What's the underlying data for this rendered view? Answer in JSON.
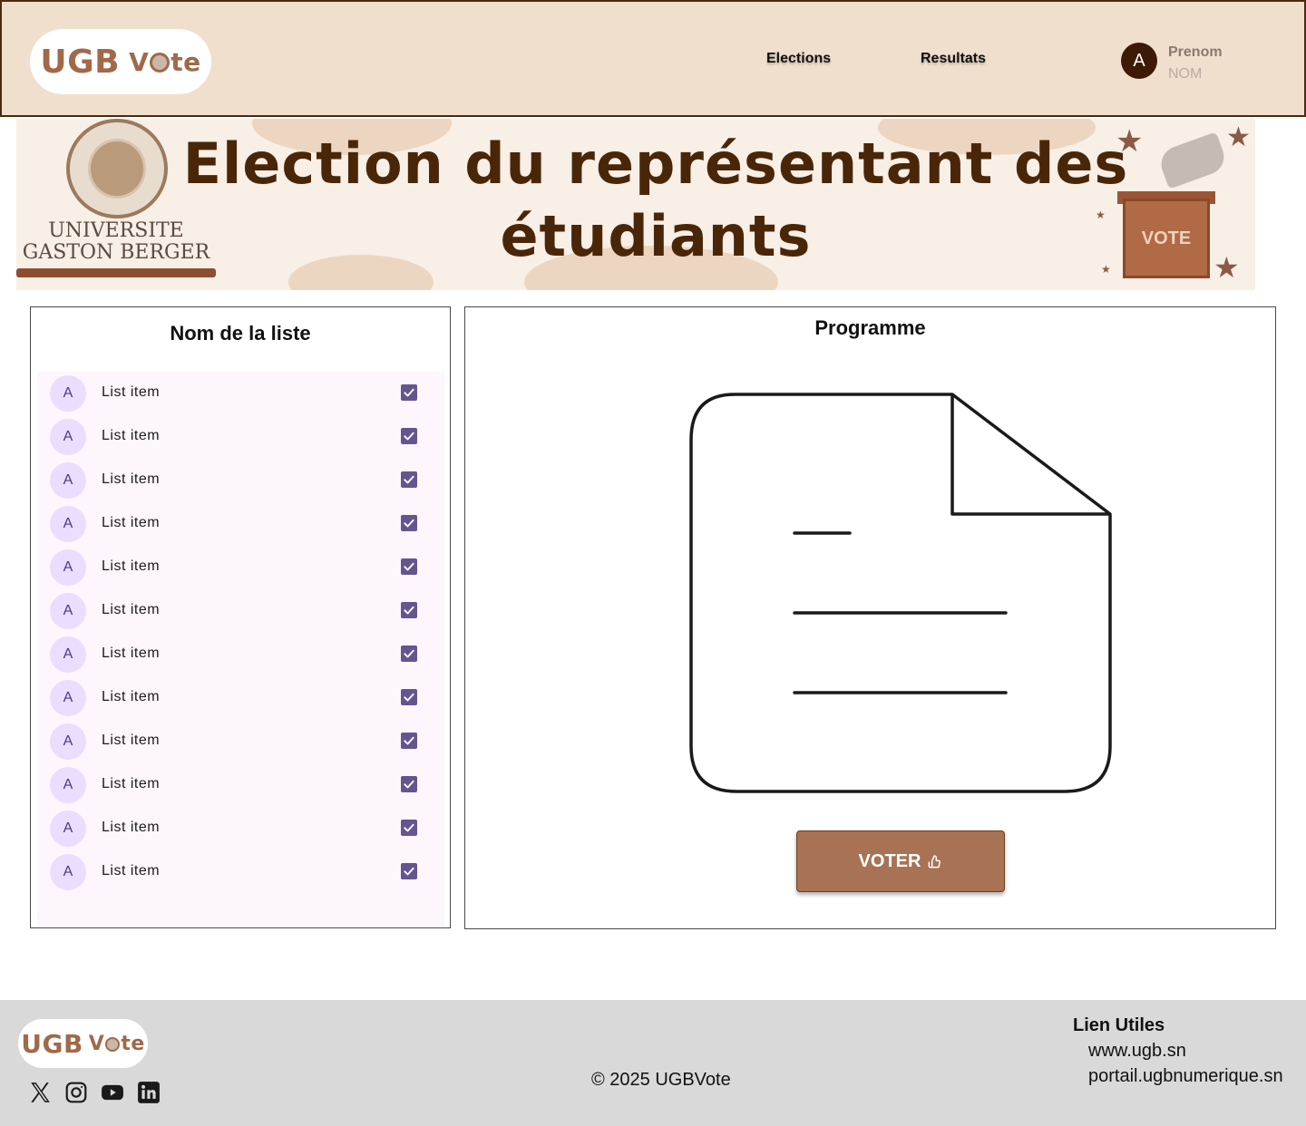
{
  "header": {
    "logo": "UGB Vote",
    "nav": [
      {
        "label": "Elections"
      },
      {
        "label": "Resultats"
      }
    ],
    "user": {
      "avatar_initial": "A",
      "first_name": "Prenom",
      "last_name": "NOM"
    }
  },
  "banner": {
    "title": "Election du représentant des étudiants",
    "university": "UNIVERSITE GASTON BERGER",
    "ballot_label": "VOTE"
  },
  "list_panel": {
    "title": "Nom de la liste",
    "items": [
      {
        "avatar": "A",
        "label": "List item",
        "checked": true
      },
      {
        "avatar": "A",
        "label": "List item",
        "checked": true
      },
      {
        "avatar": "A",
        "label": "List item",
        "checked": true
      },
      {
        "avatar": "A",
        "label": "List item",
        "checked": true
      },
      {
        "avatar": "A",
        "label": "List item",
        "checked": true
      },
      {
        "avatar": "A",
        "label": "List item",
        "checked": true
      },
      {
        "avatar": "A",
        "label": "List item",
        "checked": true
      },
      {
        "avatar": "A",
        "label": "List item",
        "checked": true
      },
      {
        "avatar": "A",
        "label": "List item",
        "checked": true
      },
      {
        "avatar": "A",
        "label": "List item",
        "checked": true
      },
      {
        "avatar": "A",
        "label": "List item",
        "checked": true
      },
      {
        "avatar": "A",
        "label": "List item",
        "checked": true
      }
    ]
  },
  "programme": {
    "title": "Programme",
    "icon": "document-icon",
    "vote_button": "VOTER"
  },
  "footer": {
    "logo": "UGB Vote",
    "social": [
      "x-icon",
      "instagram-icon",
      "youtube-icon",
      "linkedin-icon"
    ],
    "copyright": "© 2025 UGBVote",
    "links_title": "Lien Utiles",
    "links": [
      "www.ugb.sn",
      "portail.ugbnumerique.sn"
    ]
  },
  "colors": {
    "header_bg": "#f0dfcd",
    "brand_brown": "#a0694a",
    "button_brown": "#a87254",
    "footer_bg": "#d9d9d9",
    "checkbox": "#65558f",
    "avatar_bg": "#eaddff"
  }
}
